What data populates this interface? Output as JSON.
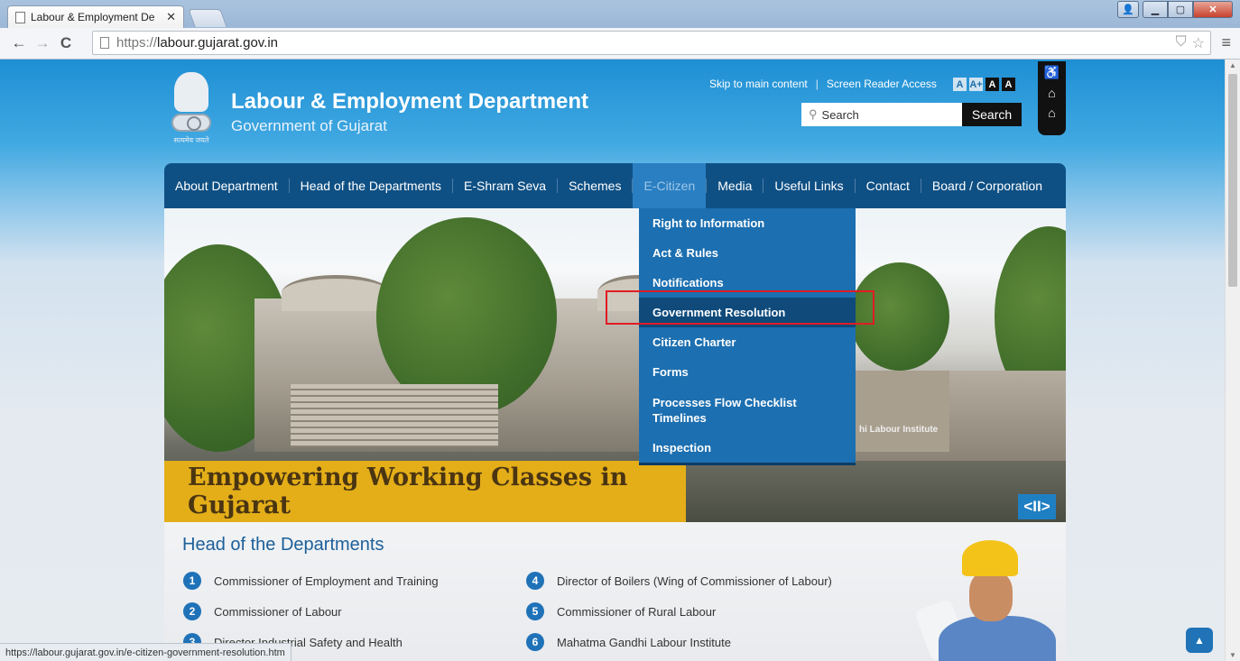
{
  "browser": {
    "tab_title": "Labour & Employment De",
    "tab_close": "✕",
    "url_scheme": "https://",
    "url_host": "labour.gujarat.gov.in",
    "status_url": "https://labour.gujarat.gov.in/e-citizen-government-resolution.htm"
  },
  "header": {
    "emblem_motto": "सत्यमेव जयते",
    "title": "Labour & Employment Department",
    "subtitle": "Government of Gujarat",
    "skip_link": "Skip to main content",
    "separator": "|",
    "screen_reader": "Screen Reader Access",
    "font_buttons": [
      "A",
      "A+",
      "A",
      "A"
    ],
    "search_placeholder": "Search",
    "search_button": "Search"
  },
  "nav": {
    "items": [
      "About Department",
      "Head of the Departments",
      "E-Shram Seva",
      "Schemes",
      "E-Citizen",
      "Media",
      "Useful Links",
      "Contact",
      "Board / Corporation"
    ],
    "active_index": 4
  },
  "dropdown": {
    "items": [
      "Right to Information",
      "Act & Rules",
      "Notifications",
      "Government Resolution",
      "Citizen Charter",
      "Forms",
      "Processes Flow Checklist",
      "Timelines",
      "Inspection"
    ],
    "hover_index": 3
  },
  "banner": {
    "tagline": "Empowering Working Classes in Gujarat",
    "slider_control": "<II>",
    "sign_text": "hi Labour Institute"
  },
  "hod": {
    "title": "Head of the Departments",
    "items": [
      {
        "num": "1",
        "label": "Commissioner of Employment and Training"
      },
      {
        "num": "2",
        "label": "Commissioner of Labour"
      },
      {
        "num": "3",
        "label": "Director Industrial Safety and Health"
      },
      {
        "num": "4",
        "label": "Director of Boilers (Wing of Commissioner of Labour)"
      },
      {
        "num": "5",
        "label": "Commissioner of Rural Labour"
      },
      {
        "num": "6",
        "label": "Mahatma Gandhi Labour Institute"
      }
    ]
  },
  "colors": {
    "nav_bg": "#0f5084",
    "dropdown_bg": "#1c6fb0",
    "dropdown_hover": "#0f4a7b",
    "tagline_bg": "#e4ae19",
    "highlight": "#e01c24"
  }
}
